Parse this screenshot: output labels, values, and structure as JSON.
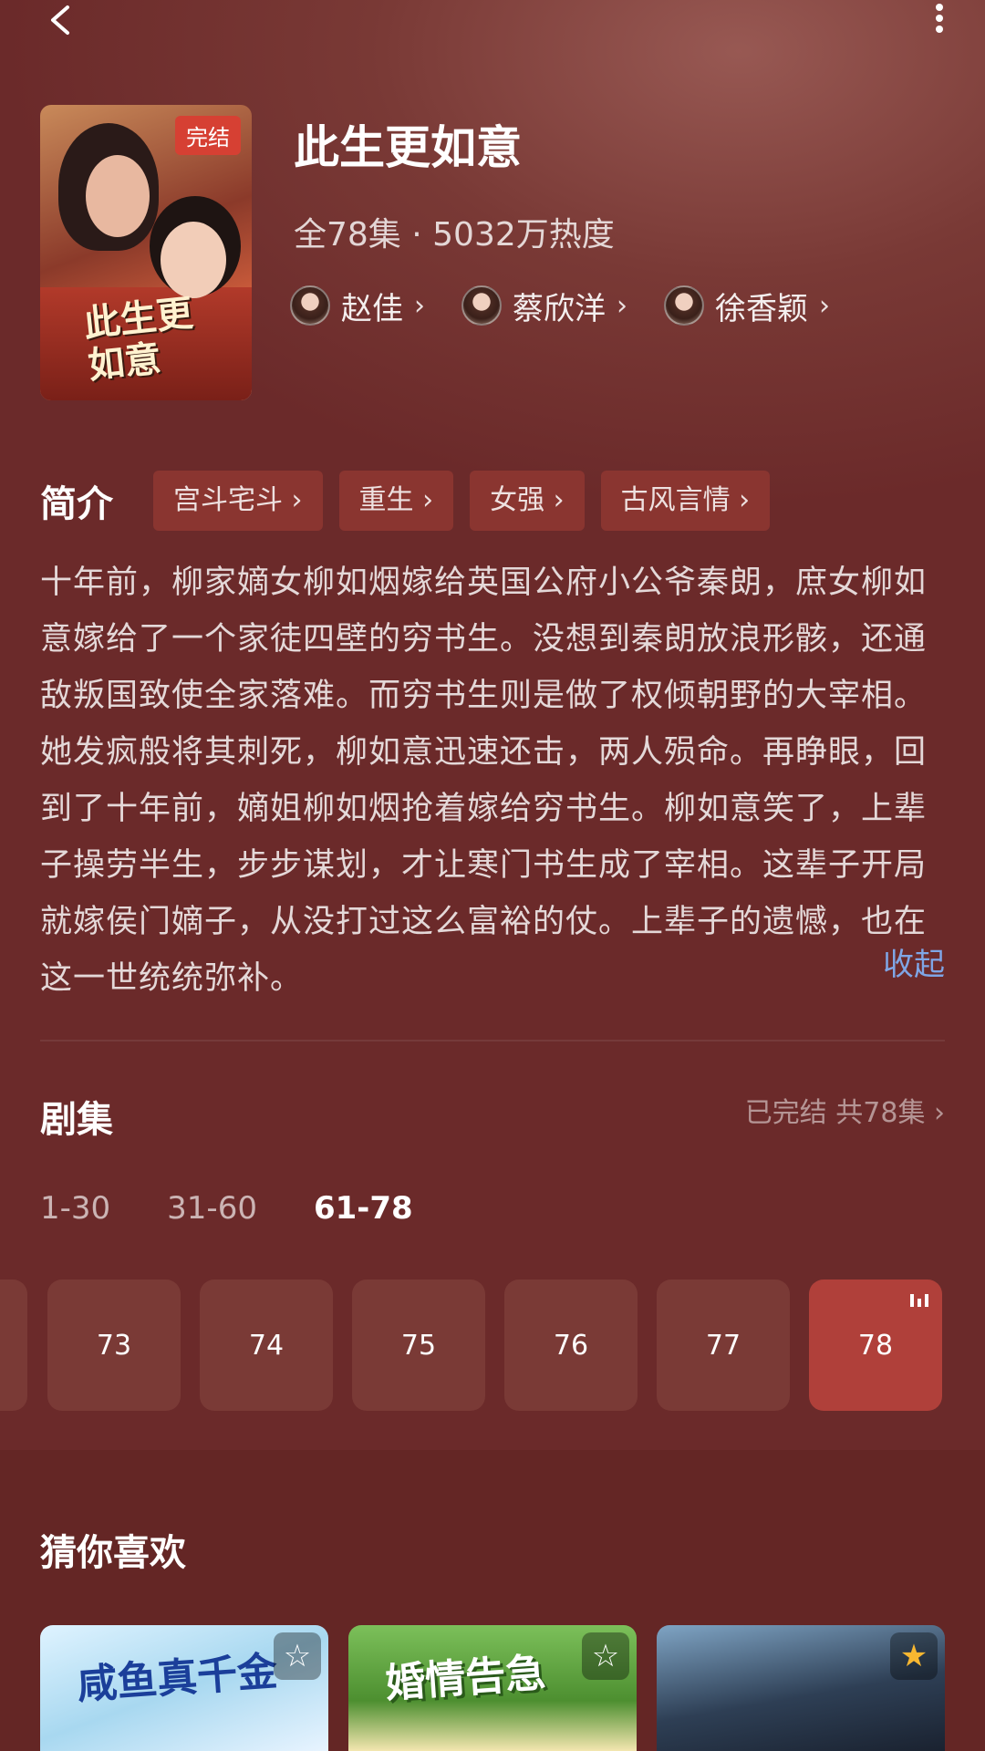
{
  "drama": {
    "title": "此生更如意",
    "meta": "全78集 · 5032万热度",
    "poster_badge": "完结",
    "poster_title": "此生更如意"
  },
  "cast": [
    {
      "name": "赵佳"
    },
    {
      "name": "蔡欣洋"
    },
    {
      "name": "徐香颖"
    }
  ],
  "intro": {
    "label": "简介",
    "tags": [
      "宫斗宅斗",
      "重生",
      "女强",
      "古风言情"
    ],
    "description": "十年前，柳家嫡女柳如烟嫁给英国公府小公爷秦朗，庶女柳如意嫁给了一个家徒四壁的穷书生。没想到秦朗放浪形骸，还通敌叛国致使全家落难。而穷书生则是做了权倾朝野的大宰相。她发疯般将其刺死，柳如意迅速还击，两人殒命。再睁眼，回到了十年前，嫡姐柳如烟抢着嫁给穷书生。柳如意笑了，上辈子操劳半生，步步谋划，才让寒门书生成了宰相。这辈子开局就嫁侯门嫡子，从没打过这么富裕的仗。上辈子的遗憾，也在这一世统统弥补。",
    "collapse": "收起"
  },
  "episodes": {
    "label": "剧集",
    "status": "已完结 共78集",
    "ranges": [
      "1-30",
      "31-60",
      "61-78"
    ],
    "active_range": 2,
    "items": [
      "73",
      "74",
      "75",
      "76",
      "77",
      "78"
    ],
    "current": "78"
  },
  "recommend": {
    "label": "猜你喜欢",
    "items": [
      {
        "title": "咸鱼真千金",
        "starred": false
      },
      {
        "title": "婚情告急",
        "starred": false
      },
      {
        "title": "",
        "starred": true
      }
    ]
  },
  "colors": {
    "background": "#6b2a2a",
    "accent": "#b0403a",
    "link": "#7fa6e6",
    "star": "#f7b731"
  }
}
